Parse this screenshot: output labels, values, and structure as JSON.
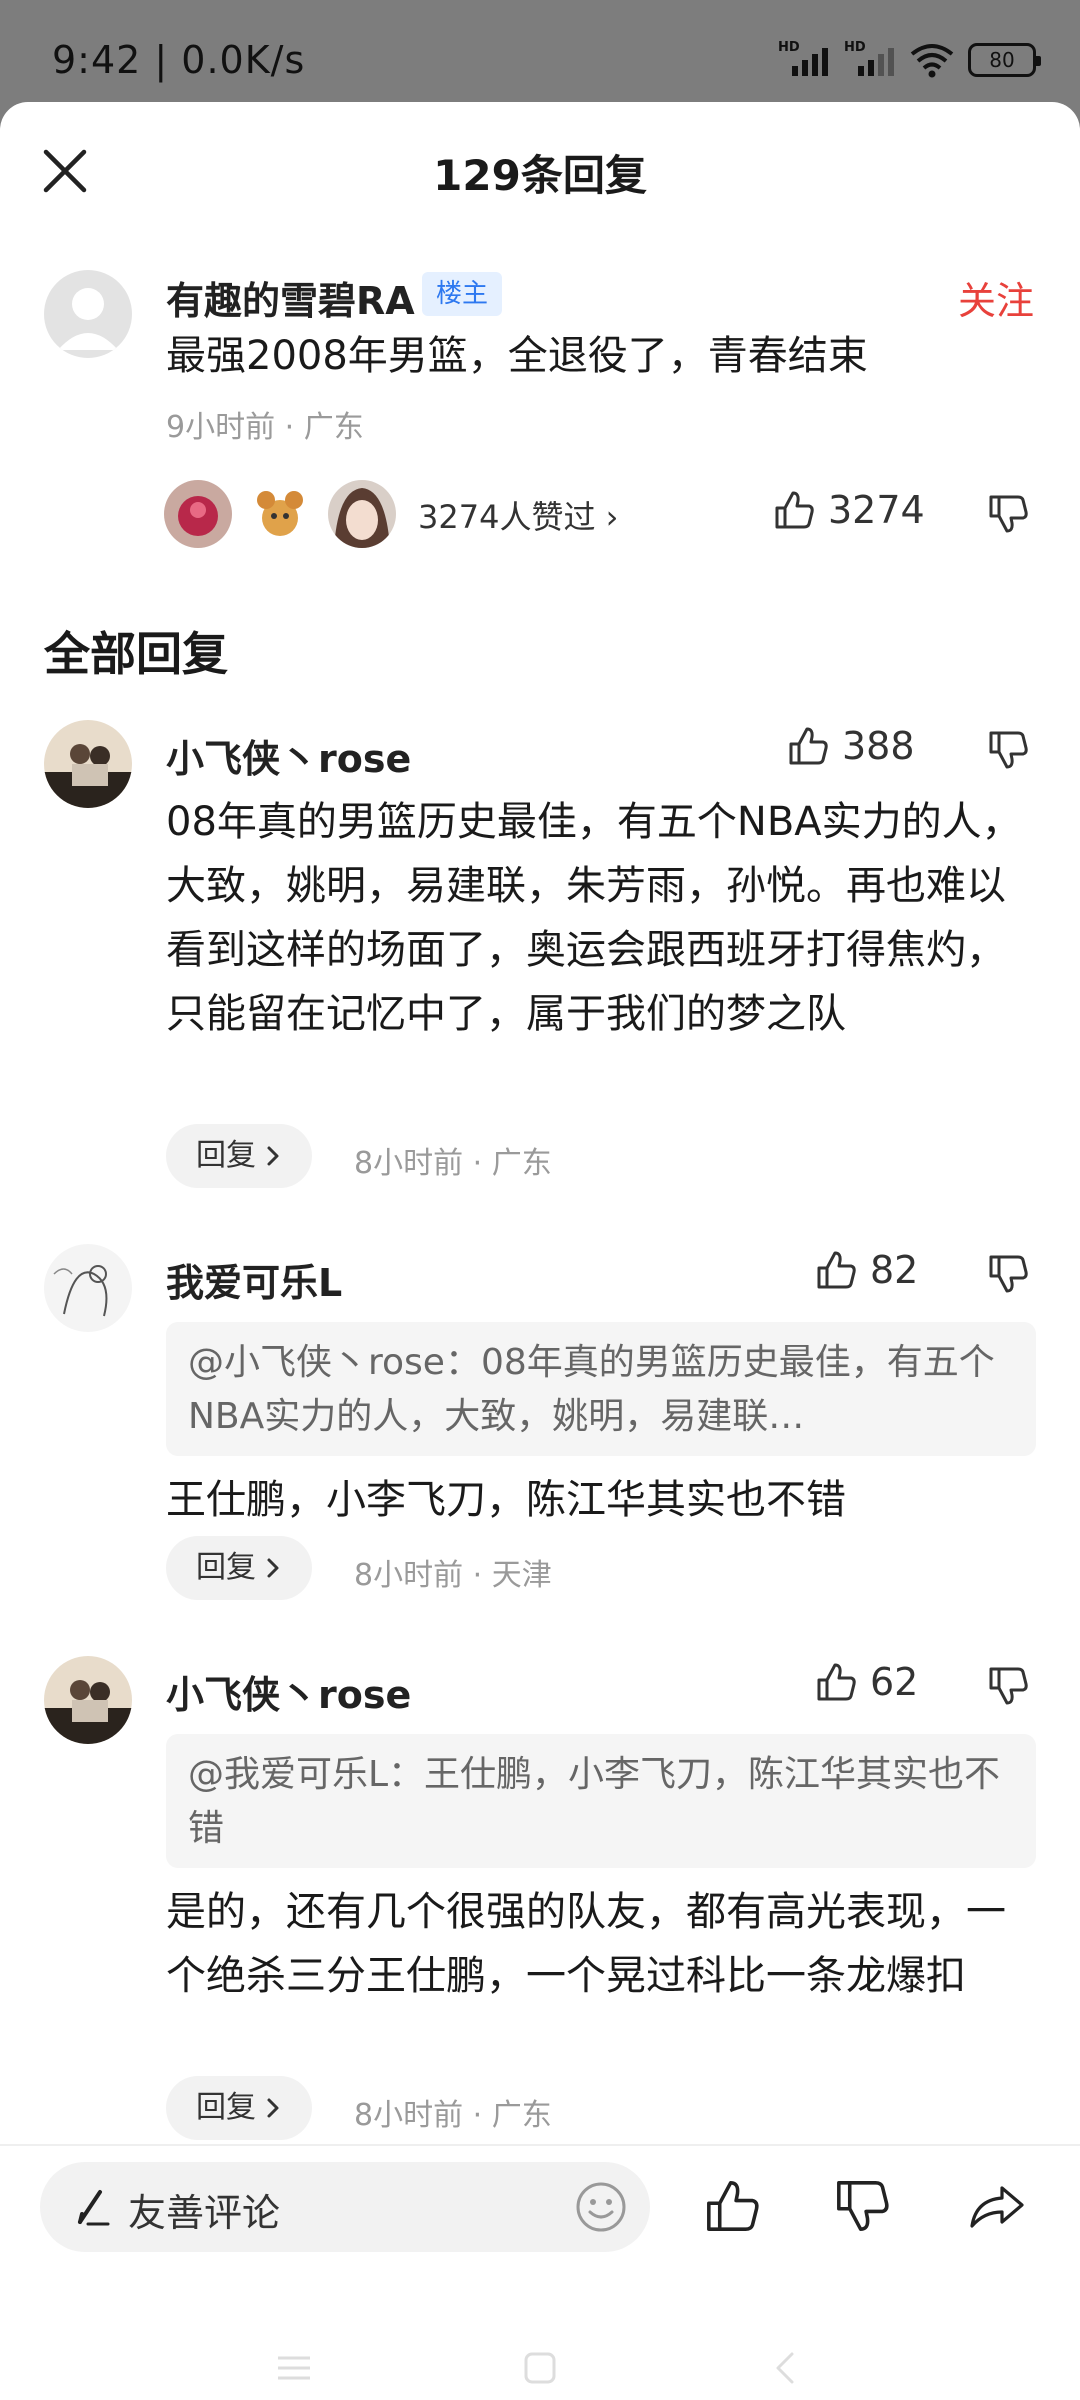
{
  "status_bar": {
    "time": "9:42 | 0.0K/s",
    "signal_label": "HD",
    "battery": "80"
  },
  "sheet": {
    "title": "129条回复"
  },
  "main_comment": {
    "username": "有趣的雪碧RA",
    "badge": "楼主",
    "follow_label": "关注",
    "text": "最强2008年男篮，全退役了，青春结束",
    "meta": "9小时前 · 广东",
    "likers_text": "3274人赞过 ›",
    "like_count": "3274"
  },
  "section_title": "全部回复",
  "replies": [
    {
      "username": "小飞侠丶rose",
      "like_count": "388",
      "text": "08年真的男篮历史最佳，有五个NBA实力的人，大致，姚明，易建联，朱芳雨，孙悦。再也难以看到这样的场面了，奥运会跟西班牙打得焦灼，只能留在记忆中了，属于我们的梦之队",
      "reply_label": "回复",
      "meta": "8小时前 · 广东"
    },
    {
      "username": "我爱可乐L",
      "like_count": "82",
      "quote": "@小飞侠丶rose：08年真的男篮历史最佳，有五个NBA实力的人，大致，姚明，易建联…",
      "text": "王仕鹏，小李飞刀，陈江华其实也不错",
      "reply_label": "回复",
      "meta": "8小时前 · 天津"
    },
    {
      "username": "小飞侠丶rose",
      "like_count": "62",
      "quote": "@我爱可乐L：王仕鹏，小李飞刀，陈江华其实也不错",
      "text": "是的，还有几个很强的队友，都有高光表现，一个绝杀三分王仕鹏，一个晃过科比一条龙爆扣",
      "reply_label": "回复",
      "meta": "8小时前 · 广东"
    }
  ],
  "bottom_bar": {
    "input_placeholder": "友善评论"
  },
  "colors": {
    "accent_red": "#e8413b",
    "badge_blue": "#2d78f0",
    "meta_gray": "#9a9a9a"
  }
}
